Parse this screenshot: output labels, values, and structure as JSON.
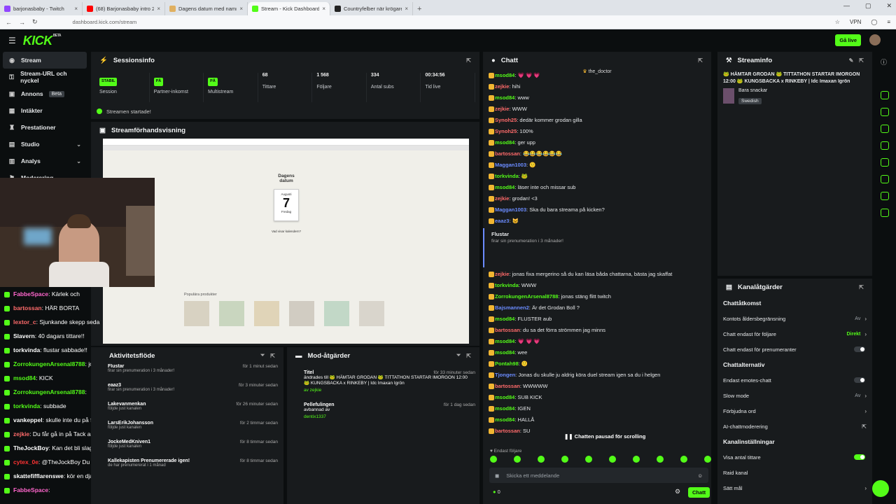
{
  "browser": {
    "tabs": [
      {
        "label": "barjonasbaby - Twitch",
        "color": "#9146ff"
      },
      {
        "label": "(68) Barjonasbaby intro 2026?",
        "color": "#ff0000"
      },
      {
        "label": "Dagens datum med namnsdag...",
        "color": "#e0b060"
      },
      {
        "label": "Stream - Kick Dashboard",
        "color": "#53fc18",
        "active": true
      },
      {
        "label": "Countryfelber när krögare och f...",
        "color": "#222"
      }
    ],
    "url": "dashboard.kick.com/stream",
    "vpn": "VPN"
  },
  "topbar": {
    "logo": "KICK",
    "beta": "BETA",
    "go_live": "Gå live"
  },
  "sidebar": {
    "items": [
      {
        "label": "Stream",
        "icon": "◉",
        "active": true
      },
      {
        "label": "Stream-URL och nyckel",
        "icon": "⚿"
      },
      {
        "label": "Annons",
        "icon": "▣",
        "beta": "Beta"
      },
      {
        "label": "Intäkter",
        "icon": "▦"
      },
      {
        "label": "Prestationer",
        "icon": "♜"
      },
      {
        "label": "Studio",
        "icon": "▤",
        "chev": true
      },
      {
        "label": "Analys",
        "icon": "▥",
        "chev": true
      },
      {
        "label": "Moderering",
        "icon": "⚑"
      }
    ]
  },
  "session": {
    "title": "Sessionsinfo",
    "stats": [
      {
        "badge": "STABIL",
        "label": "Session"
      },
      {
        "badge": "PÅ",
        "label": "Partner-inkomst"
      },
      {
        "badge": "PÅ",
        "label": "Multistream"
      },
      {
        "value": "68",
        "label": "Tittare"
      },
      {
        "value": "1 568",
        "label": "Följare"
      },
      {
        "value": "334",
        "label": "Antal subs"
      },
      {
        "value": "00:34:56",
        "label": "Tid live"
      }
    ],
    "started": "Streamen startade!"
  },
  "preview": {
    "title": "Streamförhandsvisning",
    "page_heading": "Dagens datum",
    "month": "Augusti",
    "day": "7",
    "weekday": "Fredag",
    "question": "Vad visar kalendern?",
    "products": "Populära produkter"
  },
  "overlay_chat": [
    {
      "user": "FabbeSpace",
      "text": "Kärlek och",
      "color": "#ff66cc"
    },
    {
      "user": "bartossan",
      "text": "HÄR BORTA",
      "color": "#ff6b6b"
    },
    {
      "user": "lextor_c",
      "text": "Sjunkande skepp seda",
      "color": "#ff6b6b"
    },
    {
      "user": "Slavern",
      "text": "40 dagars tittare!!",
      "color": "#ffffff"
    },
    {
      "user": "torkvinda",
      "text": "flustar sabbade!!",
      "color": "#ffffff"
    },
    {
      "user": "ZorrokungenArsenal8788",
      "text": "jonas ja skallar dig om dj kör hor twitch",
      "color": "#53fc18"
    },
    {
      "user": "msod84",
      "text": "KICK",
      "color": "#53fc18"
    },
    {
      "user": "ZorrokungenArsenal8788",
      "text": "",
      "color": "#53fc18"
    },
    {
      "user": "torkvinda",
      "text": "subbade",
      "color": "#53fc18"
    },
    {
      "user": "vankeppel",
      "text": "skulle inte du på festival i malmö med dentix? @barjonasbaby",
      "color": "#ffffff"
    },
    {
      "user": "zejkie",
      "text": "Du får gå in på Tack an kanalen och köpa en fin outfit, en hatt kostar 2000 bara",
      "color": "#ff6b6b"
    },
    {
      "user": "TheJockBoy",
      "text": "Kan det bli slagsmål mellan dig och perra?",
      "color": "#ffffff"
    },
    {
      "user": "cytex_0e",
      "text": "@TheJockBoy Du far utbilda henne då",
      "color": "#ff3333"
    },
    {
      "user": "skattefifflarenswe",
      "text": "kör en django mojgrodan",
      "color": "#ffffff"
    },
    {
      "user": "FabbeSpace",
      "text": "",
      "color": "#ff66cc"
    }
  ],
  "activity": {
    "title": "Aktivitetsflöde",
    "items": [
      {
        "user": "Flustar",
        "text": "firar sin prenumeration i 3 månader!",
        "time": "för 1 minut sedan"
      },
      {
        "user": "eaaz3",
        "text": "firar sin prenumeration i 3 månader!",
        "time": "för 3 minuter sedan"
      },
      {
        "user": "Lakevanmenkan",
        "text": "följde just kanalen",
        "time": "för 26 minuter sedan"
      },
      {
        "user": "LarsErikJohansson",
        "text": "följde just kanalen",
        "time": "för 2 timmar sedan"
      },
      {
        "user": "JockeMedKniven1",
        "text": "följde just kanalen",
        "time": "för 8 timmar sedan"
      },
      {
        "user": "Kallekapisten Prenumererade igen!",
        "text": "de har prenumererat i 1 månad",
        "time": "för 8 timmar sedan"
      }
    ]
  },
  "mod": {
    "title": "Mod-åtgärder",
    "items": [
      {
        "title": "Titel",
        "text": "ändrades till 🐸 HÄMTAR GRODAN 🐸 TITTATHON STARTAR IMORGON 12:00 🐸 KUNGSBACKA x RINKEBY | Idc Imaxan Igrön",
        "by": "av zejkie",
        "time": "för 33 minuter sedan"
      },
      {
        "title": "Pellefulingen",
        "text": "avbannad av",
        "by": "dentix1337",
        "time": "för 1 dag sedan"
      }
    ]
  },
  "chat": {
    "title": "Chatt",
    "pinned": "the_doctor",
    "messages": [
      {
        "user": "msod84",
        "text": ": 💗 💗 💗",
        "color": "#53fc18"
      },
      {
        "user": "zejkie",
        "text": ": hihi",
        "color": "#ff6b6b"
      },
      {
        "user": "msod84",
        "text": ": www",
        "color": "#53fc18"
      },
      {
        "user": "zejkie",
        "text": ": WWW",
        "color": "#ff6b6b"
      },
      {
        "user": "Synoh25",
        "text": ": dedär kommer grodan gilla",
        "color": "#ff6b6b"
      },
      {
        "user": "Synoh25",
        "text": ": 100%",
        "color": "#ff6b6b"
      },
      {
        "user": "msod84",
        "text": ": ger upp",
        "color": "#53fc18"
      },
      {
        "user": "bartossan",
        "text": ": 😂😂😂😂😂😂",
        "color": "#ff6b6b"
      },
      {
        "user": "Maggan1003",
        "text": ": 🙂",
        "color": "#6b8cff"
      },
      {
        "user": "torkvinda",
        "text": ": 🐸",
        "color": "#53fc18"
      },
      {
        "user": "msod84",
        "text": ": läser inte och missar sub",
        "color": "#53fc18"
      },
      {
        "user": "zejkie",
        "text": ": grodan! <3",
        "color": "#ff6b6b"
      },
      {
        "user": "Maggan1003",
        "text": ": Ska du bara streama på kicken?",
        "color": "#6b8cff"
      },
      {
        "user": "eaaz3",
        "text": ": 😺",
        "color": "#6b8cff"
      }
    ],
    "sub": {
      "user": "Flustar",
      "text": "firar sin prenumeration i 3 månader!"
    },
    "messages2": [
      {
        "user": "zejkie",
        "text": ": jonas fixa mergerino så du kan läsa båda chattarna, bästa jag skaffat",
        "color": "#ff6b6b"
      },
      {
        "user": "torkvinda",
        "text": ": WWW",
        "color": "#53fc18"
      },
      {
        "user": "ZorrokungenArsenal8788",
        "text": ": jonas stäng flitt twitch",
        "color": "#53fc18"
      },
      {
        "user": "Bajsmannen2",
        "text": ": Är det Grodan Boll ?",
        "color": "#6b8cff"
      },
      {
        "user": "msod84",
        "text": ": FLUSTER aub",
        "color": "#53fc18"
      },
      {
        "user": "bartossan",
        "text": ": du sa det förra strömmen jag minns",
        "color": "#ff6b6b"
      },
      {
        "user": "msod84",
        "text": ": 💗 💗 💗",
        "color": "#53fc18"
      },
      {
        "user": "msod84",
        "text": ": wee",
        "color": "#53fc18"
      },
      {
        "user": "Pontah98",
        "text": ": 🙂",
        "color": "#53fc18"
      },
      {
        "user": "Tjongen",
        "text": ": Jonas du skulle ju aldrig köra duel stream igen sa du i helgen",
        "color": "#6b8cff"
      },
      {
        "user": "bartossan",
        "text": ": WWWWW",
        "color": "#ff6b6b"
      },
      {
        "user": "msod84",
        "text": ": SUB KICK",
        "color": "#53fc18"
      },
      {
        "user": "msod84",
        "text": ": IGEN",
        "color": "#53fc18"
      },
      {
        "user": "msod84",
        "text": ": HALLÅ",
        "color": "#53fc18"
      },
      {
        "user": "bartossan",
        "text": ": SU",
        "color": "#ff6b6b"
      }
    ],
    "paused": "Chatten pausad för scrolling",
    "followers_only": "Endast följare",
    "placeholder": "Skicka ett meddelande",
    "count": "0",
    "send": "Chatt"
  },
  "streaminfo": {
    "title": "Streaminfo",
    "stream_title": "🐸 HÄMTAR GRODAN 🐸 TITTATHON STARTAR IMORGON 12:00 🐸 KUNGSBACKA x RINKEBY | Idc Imaxan Igrön",
    "category": "Bara snackar",
    "language": "Swedish"
  },
  "channel": {
    "title": "Kanalåtgärder",
    "chat_access": "Chattåtkomst",
    "rows1": [
      {
        "label": "Kontots åldersbegränsning",
        "value": "Av",
        "type": "chev"
      },
      {
        "label": "Chatt endast för följare",
        "value": "Direkt",
        "type": "chev-green"
      },
      {
        "label": "Chatt endast för prenumeranter",
        "type": "toggle-off"
      }
    ],
    "chat_options": "Chattalternativ",
    "rows2": [
      {
        "label": "Endast emotes-chatt",
        "type": "toggle-off"
      },
      {
        "label": "Slow mode",
        "value": "Av",
        "type": "chev"
      },
      {
        "label": "Förbjudna ord",
        "type": "chev"
      },
      {
        "label": "AI-chattmoderering",
        "type": "ext"
      }
    ],
    "channel_settings": "Kanalinställningar",
    "rows3": [
      {
        "label": "Visa antal tittare",
        "type": "toggle-on"
      },
      {
        "label": "Raid kanal",
        "type": "none"
      },
      {
        "label": "Sätt mål",
        "type": "chev"
      }
    ]
  }
}
